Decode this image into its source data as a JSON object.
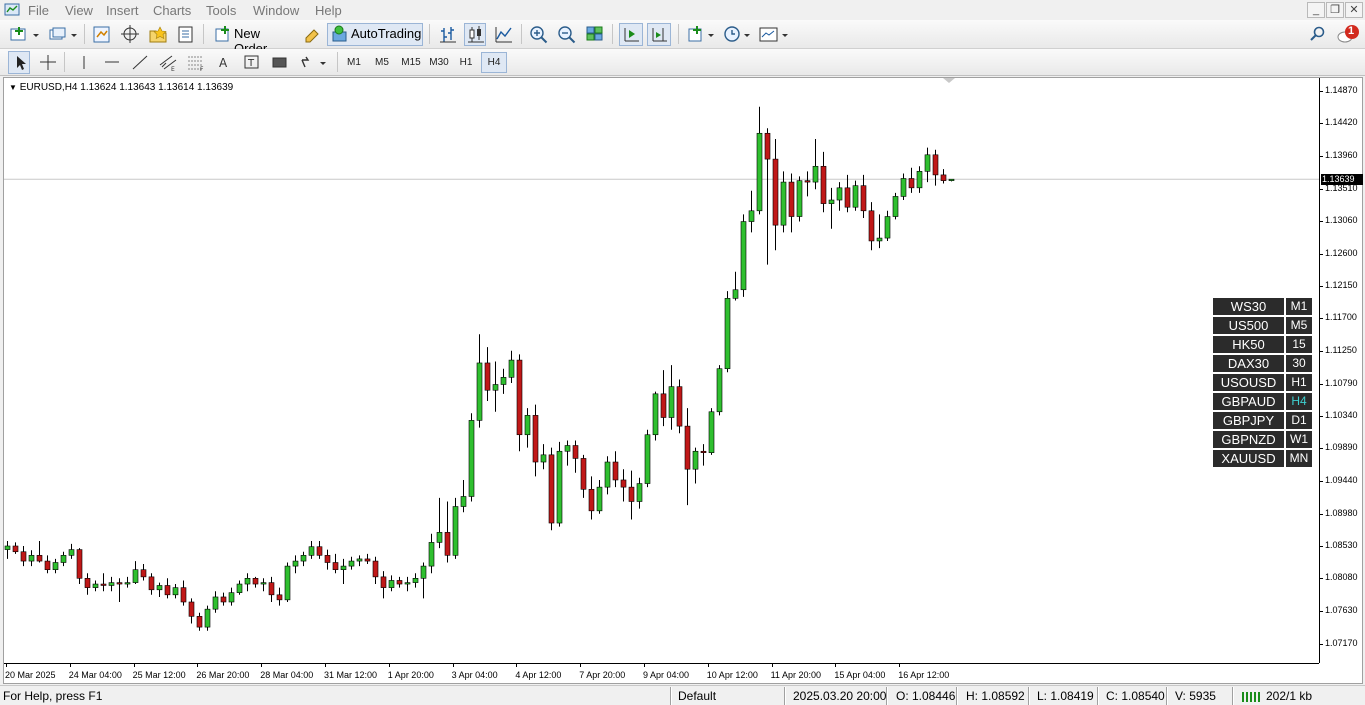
{
  "menu": [
    "File",
    "View",
    "Insert",
    "Charts",
    "Tools",
    "Window",
    "Help"
  ],
  "toolbar": {
    "new_order": "New Order",
    "autotrading": "AutoTrading"
  },
  "timeframes": [
    "M1",
    "M5",
    "M15",
    "M30",
    "H1",
    "H4"
  ],
  "active_timeframe": "H4",
  "notification_count": "1",
  "chart": {
    "header": "EURUSD,H4  1.13624 1.13643 1.13614 1.13639",
    "current_price": "1.13639",
    "price_labels": [
      "1.14870",
      "1.14420",
      "1.13960",
      "1.13510",
      "1.13060",
      "1.12600",
      "1.12150",
      "1.11700",
      "1.11250",
      "1.10790",
      "1.10340",
      "1.09890",
      "1.09440",
      "1.08980",
      "1.08530",
      "1.08080",
      "1.07630",
      "1.07170"
    ],
    "time_labels": [
      "20 Mar 2025",
      "24 Mar 04:00",
      "25 Mar 12:00",
      "26 Mar 20:00",
      "28 Mar 04:00",
      "31 Mar 12:00",
      "1 Apr 20:00",
      "3 Apr 04:00",
      "4 Apr 12:00",
      "7 Apr 20:00",
      "9 Apr 04:00",
      "10 Apr 12:00",
      "11 Apr 20:00",
      "15 Apr 04:00",
      "16 Apr 12:00"
    ]
  },
  "colors": {
    "bull": "#2fbf2f",
    "bear": "#c01818",
    "grid_line": "#c8c8c8"
  },
  "symbols": [
    {
      "name": "WS30",
      "tf": "M1"
    },
    {
      "name": "US500",
      "tf": "M5"
    },
    {
      "name": "HK50",
      "tf": "15"
    },
    {
      "name": "DAX30",
      "tf": "30"
    },
    {
      "name": "USOUSD",
      "tf": "H1"
    },
    {
      "name": "GBPAUD",
      "tf": "H4"
    },
    {
      "name": "GBPJPY",
      "tf": "D1"
    },
    {
      "name": "GBPNZD",
      "tf": "W1"
    },
    {
      "name": "XAUUSD",
      "tf": "MN"
    }
  ],
  "status": {
    "help": "For Help, press F1",
    "profile": "Default",
    "datetime": "2025.03.20 20:00",
    "open": "O: 1.08446",
    "high": "H: 1.08592",
    "low": "L: 1.08419",
    "close": "C: 1.08540",
    "volume": "V: 5935",
    "traffic": "202/1 kb"
  },
  "chart_data": {
    "type": "candlestick",
    "symbol": "EURUSD",
    "timeframe": "H4",
    "ylim": [
      1.069,
      1.1505
    ],
    "candles": [
      [
        1.0848,
        1.086,
        1.0835,
        1.0853
      ],
      [
        1.0853,
        1.0858,
        1.0842,
        1.0845
      ],
      [
        1.0845,
        1.0853,
        1.0825,
        1.0832
      ],
      [
        1.0832,
        1.0847,
        1.0825,
        1.084
      ],
      [
        1.084,
        1.086,
        1.083,
        1.0832
      ],
      [
        1.0832,
        1.084,
        1.0815,
        1.082
      ],
      [
        1.082,
        1.0835,
        1.0815,
        1.083
      ],
      [
        1.083,
        1.0845,
        1.0825,
        1.084
      ],
      [
        1.084,
        1.0856,
        1.0835,
        1.0848
      ],
      [
        1.0848,
        1.085,
        1.08,
        1.0808
      ],
      [
        1.0808,
        1.0815,
        1.0785,
        1.0795
      ],
      [
        1.0795,
        1.0805,
        1.079,
        1.08
      ],
      [
        1.08,
        1.0815,
        1.079,
        1.0798
      ],
      [
        1.0798,
        1.081,
        1.079,
        1.0802
      ],
      [
        1.0802,
        1.0808,
        1.0775,
        1.08
      ],
      [
        1.08,
        1.081,
        1.0795,
        1.0802
      ],
      [
        1.0802,
        1.0832,
        1.08,
        1.082
      ],
      [
        1.082,
        1.0828,
        1.0805,
        1.081
      ],
      [
        1.081,
        1.0815,
        1.0785,
        1.0792
      ],
      [
        1.0792,
        1.0802,
        1.0782,
        1.0798
      ],
      [
        1.0798,
        1.0808,
        1.078,
        1.0785
      ],
      [
        1.0785,
        1.08,
        1.078,
        1.0795
      ],
      [
        1.0795,
        1.0805,
        1.077,
        1.0775
      ],
      [
        1.0775,
        1.078,
        1.0745,
        1.0755
      ],
      [
        1.0755,
        1.076,
        1.0735,
        1.074
      ],
      [
        1.074,
        1.077,
        1.0735,
        1.0765
      ],
      [
        1.0765,
        1.079,
        1.076,
        1.0782
      ],
      [
        1.0782,
        1.0788,
        1.077,
        1.0775
      ],
      [
        1.0775,
        1.0795,
        1.077,
        1.0788
      ],
      [
        1.0788,
        1.0805,
        1.0785,
        1.08
      ],
      [
        1.08,
        1.0815,
        1.079,
        1.0808
      ],
      [
        1.0808,
        1.081,
        1.0795,
        1.08
      ],
      [
        1.08,
        1.0808,
        1.079,
        1.0802
      ],
      [
        1.0802,
        1.081,
        1.0775,
        1.0785
      ],
      [
        1.0785,
        1.0795,
        1.077,
        1.0778
      ],
      [
        1.0778,
        1.083,
        1.0775,
        1.0825
      ],
      [
        1.0825,
        1.084,
        1.0815,
        1.0832
      ],
      [
        1.0832,
        1.0845,
        1.0825,
        1.084
      ],
      [
        1.084,
        1.086,
        1.0835,
        1.0852
      ],
      [
        1.0852,
        1.086,
        1.0835,
        1.084
      ],
      [
        1.084,
        1.0848,
        1.082,
        1.083
      ],
      [
        1.083,
        1.0842,
        1.0815,
        1.082
      ],
      [
        1.082,
        1.0835,
        1.08,
        1.0825
      ],
      [
        1.0825,
        1.0838,
        1.082,
        1.0832
      ],
      [
        1.0832,
        1.084,
        1.0825,
        1.0835
      ],
      [
        1.0835,
        1.0842,
        1.0828,
        1.0832
      ],
      [
        1.0832,
        1.0838,
        1.08,
        1.081
      ],
      [
        1.081,
        1.0818,
        1.078,
        1.0795
      ],
      [
        1.0795,
        1.0812,
        1.079,
        1.0805
      ],
      [
        1.0805,
        1.081,
        1.0795,
        1.08
      ],
      [
        1.08,
        1.081,
        1.079,
        1.0802
      ],
      [
        1.0802,
        1.0815,
        1.0795,
        1.0808
      ],
      [
        1.0808,
        1.083,
        1.078,
        1.0825
      ],
      [
        1.0825,
        1.087,
        1.0815,
        1.0858
      ],
      [
        1.0858,
        1.092,
        1.085,
        1.0872
      ],
      [
        1.0872,
        1.0915,
        1.083,
        1.084
      ],
      [
        1.084,
        1.092,
        1.0835,
        1.0908
      ],
      [
        1.0908,
        1.0945,
        1.09,
        1.0922
      ],
      [
        1.0922,
        1.1038,
        1.0915,
        1.1028
      ],
      [
        1.1028,
        1.1148,
        1.1018,
        1.1108
      ],
      [
        1.1108,
        1.113,
        1.1055,
        1.107
      ],
      [
        1.107,
        1.111,
        1.104,
        1.1078
      ],
      [
        1.1078,
        1.11,
        1.1065,
        1.1088
      ],
      [
        1.1088,
        1.1125,
        1.108,
        1.1112
      ],
      [
        1.1112,
        1.112,
        1.0985,
        1.1008
      ],
      [
        1.1008,
        1.1045,
        1.099,
        1.1035
      ],
      [
        1.1035,
        1.105,
        1.095,
        1.097
      ],
      [
        1.097,
        1.0995,
        1.096,
        1.098
      ],
      [
        1.098,
        1.099,
        1.0875,
        1.0885
      ],
      [
        1.0885,
        1.0998,
        1.088,
        1.0985
      ],
      [
        1.0985,
        1.1,
        1.0965,
        1.0993
      ],
      [
        1.0993,
        1.1,
        1.0955,
        1.0975
      ],
      [
        1.0975,
        1.098,
        1.092,
        1.0932
      ],
      [
        1.0932,
        1.095,
        1.089,
        1.0902
      ],
      [
        1.0902,
        1.0945,
        1.0898,
        1.0935
      ],
      [
        1.0935,
        1.0978,
        1.0925,
        1.097
      ],
      [
        1.097,
        1.0985,
        1.0935,
        1.0945
      ],
      [
        1.0945,
        1.096,
        1.0915,
        1.0935
      ],
      [
        1.0935,
        1.0958,
        1.089,
        1.0915
      ],
      [
        1.0915,
        1.0948,
        1.0905,
        1.094
      ],
      [
        1.094,
        1.1015,
        1.0935,
        1.1008
      ],
      [
        1.1008,
        1.1068,
        1.1,
        1.1065
      ],
      [
        1.1065,
        1.1098,
        1.102,
        1.1032
      ],
      [
        1.1032,
        1.1105,
        1.1015,
        1.1075
      ],
      [
        1.1075,
        1.1085,
        1.101,
        1.102
      ],
      [
        1.102,
        1.1045,
        1.091,
        1.096
      ],
      [
        1.096,
        1.099,
        1.094,
        1.0985
      ],
      [
        1.0985,
        1.0995,
        1.0965,
        1.0983
      ],
      [
        1.0983,
        1.1045,
        1.098,
        1.104
      ],
      [
        1.104,
        1.1105,
        1.1035,
        1.11
      ],
      [
        1.11,
        1.1208,
        1.1095,
        1.1198
      ],
      [
        1.1198,
        1.1235,
        1.1195,
        1.121
      ],
      [
        1.121,
        1.1315,
        1.12,
        1.1305
      ],
      [
        1.1305,
        1.1348,
        1.129,
        1.132
      ],
      [
        1.132,
        1.1465,
        1.1315,
        1.1428
      ],
      [
        1.1428,
        1.1435,
        1.1245,
        1.1392
      ],
      [
        1.1392,
        1.142,
        1.1265,
        1.13
      ],
      [
        1.13,
        1.1375,
        1.129,
        1.136
      ],
      [
        1.136,
        1.1372,
        1.129,
        1.1312
      ],
      [
        1.1312,
        1.1368,
        1.1305,
        1.1362
      ],
      [
        1.1362,
        1.1375,
        1.134,
        1.136
      ],
      [
        1.136,
        1.142,
        1.135,
        1.1382
      ],
      [
        1.1382,
        1.1402,
        1.1318,
        1.133
      ],
      [
        1.133,
        1.1352,
        1.1295,
        1.1335
      ],
      [
        1.1335,
        1.136,
        1.132,
        1.1352
      ],
      [
        1.1352,
        1.137,
        1.1318,
        1.1325
      ],
      [
        1.1325,
        1.1362,
        1.132,
        1.1355
      ],
      [
        1.1355,
        1.137,
        1.131,
        1.132
      ],
      [
        1.132,
        1.1332,
        1.1265,
        1.1278
      ],
      [
        1.1278,
        1.1315,
        1.1268,
        1.1282
      ],
      [
        1.1282,
        1.132,
        1.1278,
        1.1312
      ],
      [
        1.1312,
        1.1345,
        1.1308,
        1.134
      ],
      [
        1.134,
        1.1372,
        1.1335,
        1.1365
      ],
      [
        1.1365,
        1.138,
        1.1345,
        1.1352
      ],
      [
        1.1352,
        1.1382,
        1.1345,
        1.1375
      ],
      [
        1.1375,
        1.1408,
        1.136,
        1.1398
      ],
      [
        1.1398,
        1.1405,
        1.1355,
        1.137
      ],
      [
        1.137,
        1.1378,
        1.1358,
        1.1362
      ],
      [
        1.1362,
        1.1364,
        1.1361,
        1.1364
      ]
    ]
  }
}
